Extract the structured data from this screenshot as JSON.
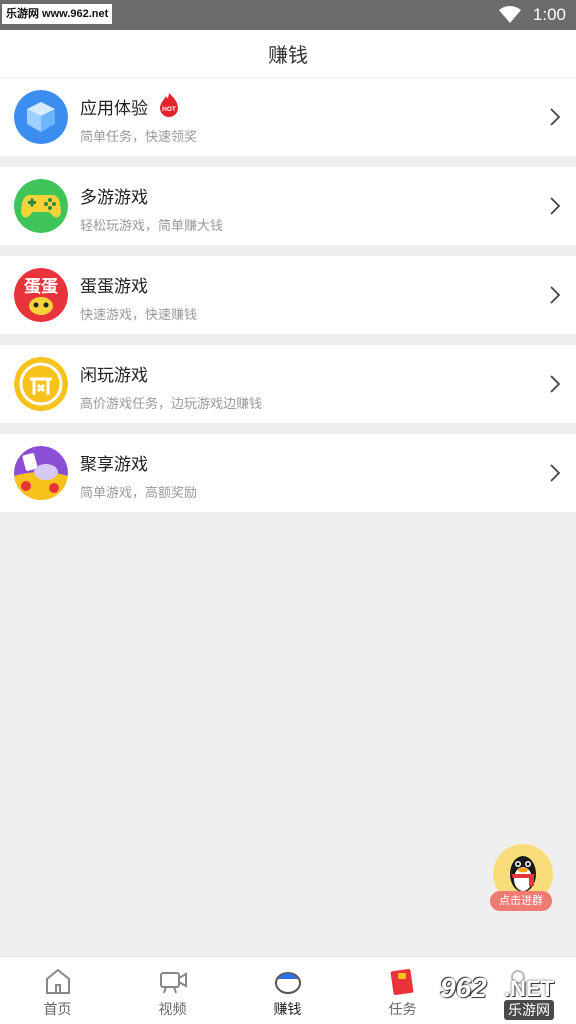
{
  "status_bar": {
    "watermark": "乐游网 www.962.net",
    "time": "1:00"
  },
  "header": {
    "title": "赚钱"
  },
  "items": [
    {
      "title": "应用体验",
      "subtitle": "简单任务，快速领奖",
      "icon": "app-experience-icon",
      "hot": "HOT"
    },
    {
      "title": "多游游戏",
      "subtitle": "轻松玩游戏，简单赚大钱",
      "icon": "gamepad-icon"
    },
    {
      "title": "蛋蛋游戏",
      "subtitle": "快速游戏，快速赚钱",
      "icon": "egg-game-icon",
      "icon_text": "蛋蛋"
    },
    {
      "title": "闲玩游戏",
      "subtitle": "高价游戏任务，边玩游戏边赚钱",
      "icon": "xianwan-icon"
    },
    {
      "title": "聚享游戏",
      "subtitle": "简单游戏，高额奖励",
      "icon": "juxiang-icon"
    }
  ],
  "qq_float": {
    "label": "点击进群"
  },
  "tabbar": {
    "tabs": [
      {
        "label": "首页",
        "icon": "home-icon"
      },
      {
        "label": "视频",
        "icon": "video-icon"
      },
      {
        "label": "赚钱",
        "icon": "earn-icon",
        "active": true
      },
      {
        "label": "任务",
        "icon": "task-icon"
      },
      {
        "label": "",
        "icon": "profile-icon"
      }
    ]
  },
  "bottom_watermark": {
    "number": "962",
    "net": ".NET",
    "cn": "乐游网"
  },
  "colors": {
    "status_bar": "#6b6b6b",
    "background": "#efefef",
    "active_tab": "#222222",
    "hot": "#e0262b"
  }
}
